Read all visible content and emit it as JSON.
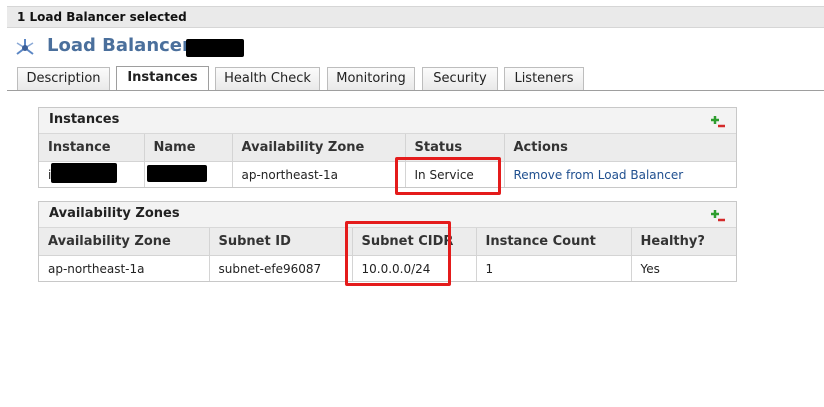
{
  "selection_bar": {
    "text": "1 Load Balancer selected"
  },
  "header": {
    "title": "Load Balancer:"
  },
  "tabs": [
    {
      "label": "Description"
    },
    {
      "label": "Instances"
    },
    {
      "label": "Health Check"
    },
    {
      "label": "Monitoring"
    },
    {
      "label": "Security"
    },
    {
      "label": "Listeners"
    }
  ],
  "active_tab": "Instances",
  "instances_panel": {
    "title": "Instances",
    "columns": [
      "Instance",
      "Name",
      "Availability Zone",
      "Status",
      "Actions"
    ],
    "rows": [
      {
        "instance_prefix": "i",
        "zone": "ap-northeast-1a",
        "status": "In Service",
        "action": "Remove from Load Balancer"
      }
    ]
  },
  "zones_panel": {
    "title": "Availability Zones",
    "columns": [
      "Availability Zone",
      "Subnet ID",
      "Subnet CIDR",
      "Instance Count",
      "Healthy?"
    ],
    "rows": [
      {
        "zone": "ap-northeast-1a",
        "subnet_id": "subnet-efe96087",
        "cidr": "10.0.0.0/24",
        "count": "1",
        "healthy": "Yes"
      }
    ]
  },
  "colors": {
    "title": "#4a6f9c",
    "highlight": "#e41b1b",
    "link": "#1f4f8f"
  }
}
